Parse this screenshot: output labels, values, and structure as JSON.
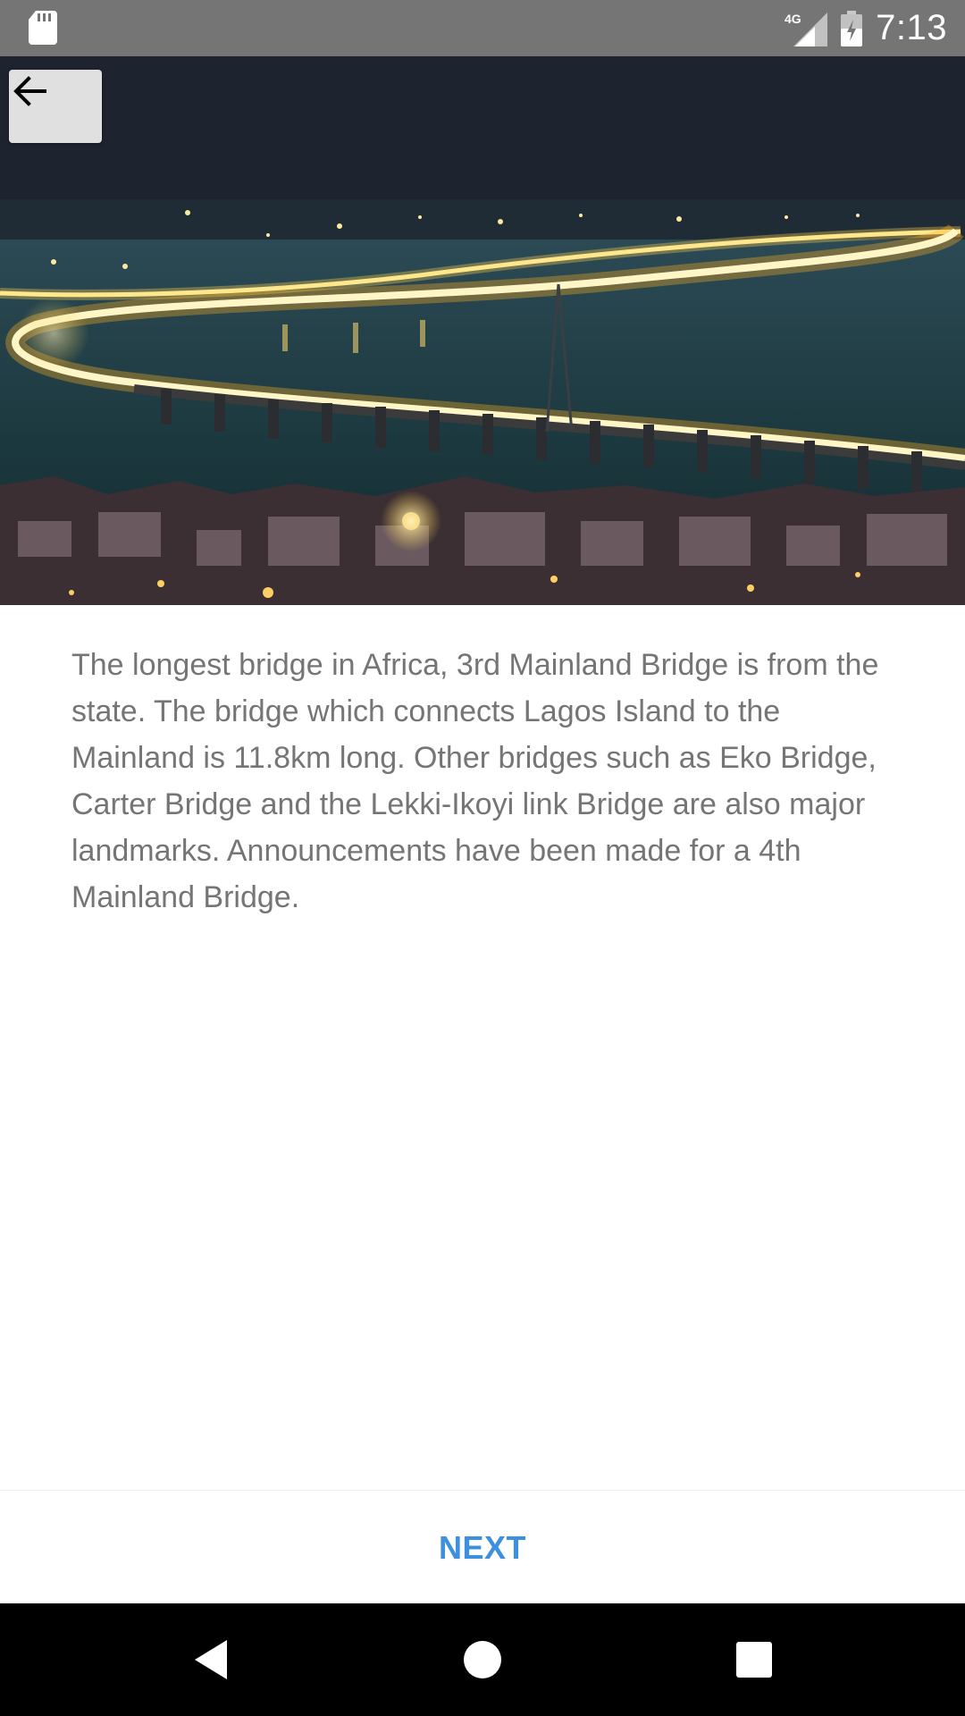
{
  "status_bar": {
    "time": "7:13",
    "network": "4G",
    "icons": [
      "sd-card-icon",
      "signal-icon",
      "battery-charging-icon"
    ]
  },
  "hero": {
    "image": "lagos-third-mainland-bridge-night-photo",
    "back_icon": "arrow-left-icon"
  },
  "content": {
    "body": "The longest bridge in Africa, 3rd Mainland Bridge is from the state. The bridge which connects Lagos Island to the Mainland is 11.8km long. Other bridges such as Eko Bridge, Carter Bridge and the Lekki-Ikoyi link Bridge are also major landmarks. Announcements have been made for a 4th Mainland Bridge."
  },
  "actions": {
    "next_label": "NEXT"
  },
  "nav_bar": {
    "icons": [
      "nav-back-icon",
      "nav-home-icon",
      "nav-recents-icon"
    ]
  },
  "colors": {
    "status_bar": "#757575",
    "accent": "#3d8fe0",
    "body_text": "#757575",
    "nav_bar": "#000000"
  }
}
